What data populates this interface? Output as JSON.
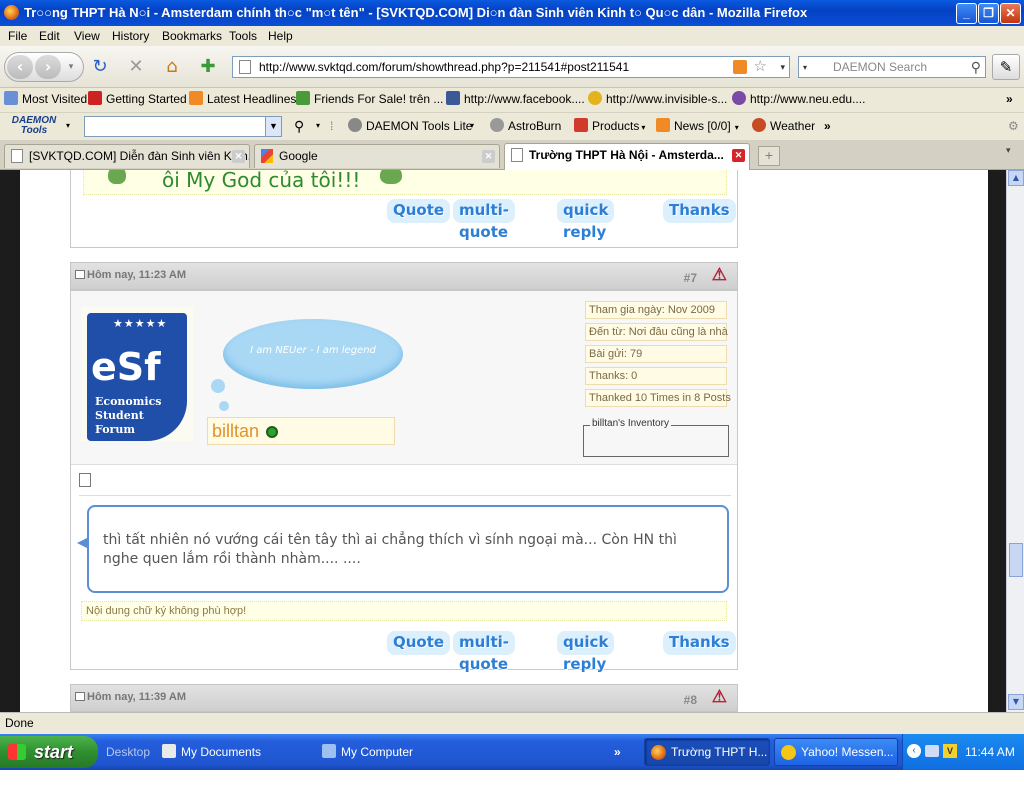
{
  "window": {
    "title": "Tr○○ng THPT Hà N○i - Amsterdam chính th○c \"m○t tên\" - [SVKTQD.COM] Di○n đàn Sinh viên Kinh t○ Qu○c dân - Mozilla Firefox"
  },
  "menu": [
    "File",
    "Edit",
    "View",
    "History",
    "Bookmarks",
    "Tools",
    "Help"
  ],
  "nav": {
    "url": "http://www.svktqd.com/forum/showthread.php?p=211541#post211541",
    "search_placeholder": "DAEMON Search"
  },
  "bookmarks": [
    {
      "label": "Most Visited",
      "icon": "most-visited-icon",
      "color": "#6b8fd6"
    },
    {
      "label": "Getting Started",
      "icon": "firefox-icon",
      "color": "#cc2222"
    },
    {
      "label": "Latest Headlines",
      "icon": "rss-icon",
      "color": "#f08a24"
    },
    {
      "label": "Friends For Sale! trên ...",
      "icon": "tag-icon",
      "color": "#4a9a3a"
    },
    {
      "label": "http://www.facebook....",
      "icon": "facebook-icon",
      "color": "#3b5998"
    },
    {
      "label": "http://www.invisible-s...",
      "icon": "smiley-icon",
      "color": "#e3b21c"
    },
    {
      "label": "http://www.neu.edu....",
      "icon": "globe-icon",
      "color": "#7a4aa8"
    }
  ],
  "daemon_toolbar": {
    "logo": "DAEMON Tools",
    "items": [
      {
        "label": "DAEMON Tools Lite",
        "icon": "daemon-icon",
        "color": "#888888"
      },
      {
        "label": "AstroBurn",
        "icon": "astroburn-icon",
        "color": "#999999"
      },
      {
        "label": "Products",
        "icon": "products-icon",
        "color": "#d13b2b"
      },
      {
        "label": "News [0/0]",
        "icon": "rss-icon",
        "color": "#f08a24"
      },
      {
        "label": "Weather",
        "icon": "weather-icon",
        "color": "#c84a22"
      }
    ]
  },
  "tabs": [
    {
      "label": "[SVKTQD.COM] Diễn đàn Sinh viên Kinh...",
      "active": false
    },
    {
      "label": "Google",
      "active": false
    },
    {
      "label": "Trường THPT Hà Nội - Amsterda...",
      "active": true
    }
  ],
  "forum": {
    "prev_signature_text": "ôi My God của tôi!!!",
    "buttons": {
      "quote": "Quote",
      "multi_quote": "multi-quote",
      "quick_reply": "quick reply",
      "thanks": "Thanks"
    },
    "post7": {
      "date": "Hôm nay, 11:23 AM",
      "number": "#7",
      "avatar_logo": "eSf",
      "avatar_caption": [
        "Economics",
        "Student",
        "Forum"
      ],
      "bubble_text": "I am NEUer - I am legend",
      "username": "billtan",
      "info": [
        "Tham gia ngày: Nov 2009",
        "Đến từ: Nơi đâu cũng là nhà",
        "Bài gửi: 79",
        "Thanks: 0",
        "Thanked 10 Times in 8 Posts"
      ],
      "inventory_label": "billtan's Inventory",
      "message": "thì tất nhiên nó vướng cái tên tây thì ai chẳng thích vì sính ngoại mà... Còn HN thì nghe quen lắm rồi thành nhàm.... ....",
      "signature": "Nội dung chữ ký không phù hợp!"
    },
    "post8": {
      "date": "Hôm nay, 11:39 AM",
      "number": "#8"
    }
  },
  "status": "Done",
  "taskbar": {
    "start": "start",
    "quick": [
      "Desktop",
      "My Documents",
      "My Computer"
    ],
    "windows": [
      {
        "label": "Trường THPT H...",
        "active": true
      },
      {
        "label": "Yahoo! Messen...",
        "active": false
      }
    ],
    "clock": "11:44 AM"
  }
}
